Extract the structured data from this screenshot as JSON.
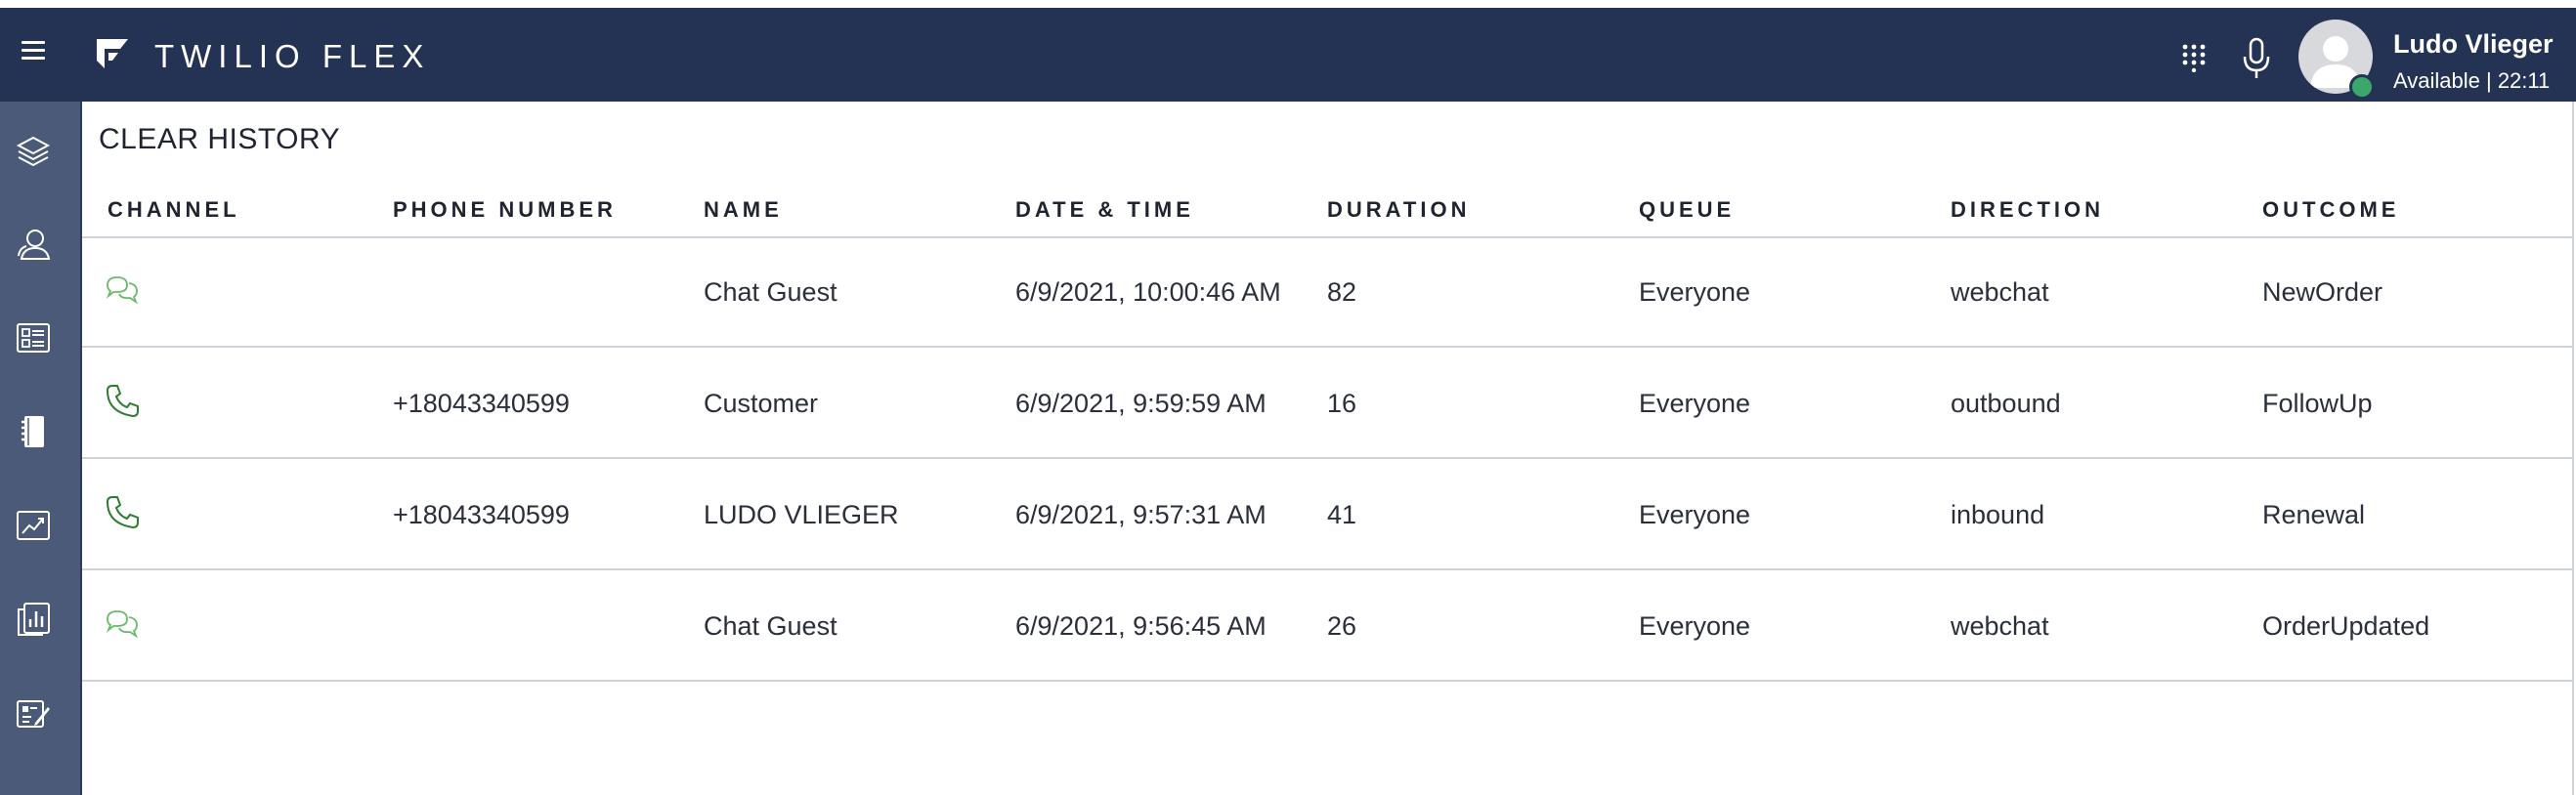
{
  "app": {
    "brand": "TWILIO FLEX",
    "colors": {
      "header": "#243354",
      "sidebar": "#4b5a78",
      "status_available": "#3aa86b",
      "chat_icon": "#6bb96b",
      "phone_icon": "#2e7d32"
    }
  },
  "header": {
    "icons": [
      "hamburger-icon",
      "twilio-flex-logo",
      "dialpad-icon",
      "microphone-icon",
      "avatar"
    ],
    "user": {
      "name": "Ludo Vlieger",
      "status": "Available | 22:11"
    }
  },
  "sidebar": {
    "items": [
      {
        "icon": "layers-icon"
      },
      {
        "icon": "agents-icon"
      },
      {
        "icon": "contact-card-icon"
      },
      {
        "icon": "notebook-icon"
      },
      {
        "icon": "analytics-chart-icon"
      },
      {
        "icon": "reports-icon"
      },
      {
        "icon": "edit-form-icon"
      }
    ]
  },
  "main": {
    "clear_history": "CLEAR HISTORY",
    "columns": [
      "CHANNEL",
      "PHONE NUMBER",
      "NAME",
      "DATE & TIME",
      "DURATION",
      "QUEUE",
      "DIRECTION",
      "OUTCOME"
    ],
    "rows": [
      {
        "channel": "chat",
        "phone": "",
        "name": "Chat Guest",
        "datetime": "6/9/2021, 10:00:46 AM",
        "duration": "82",
        "queue": "Everyone",
        "direction": "webchat",
        "outcome": "NewOrder"
      },
      {
        "channel": "voice",
        "phone": "+18043340599",
        "name": "Customer",
        "datetime": "6/9/2021, 9:59:59 AM",
        "duration": "16",
        "queue": "Everyone",
        "direction": "outbound",
        "outcome": "FollowUp"
      },
      {
        "channel": "voice",
        "phone": "+18043340599",
        "name": "LUDO VLIEGER",
        "datetime": "6/9/2021, 9:57:31 AM",
        "duration": "41",
        "queue": "Everyone",
        "direction": "inbound",
        "outcome": "Renewal"
      },
      {
        "channel": "chat",
        "phone": "",
        "name": "Chat Guest",
        "datetime": "6/9/2021, 9:56:45 AM",
        "duration": "26",
        "queue": "Everyone",
        "direction": "webchat",
        "outcome": "OrderUpdated"
      }
    ]
  }
}
